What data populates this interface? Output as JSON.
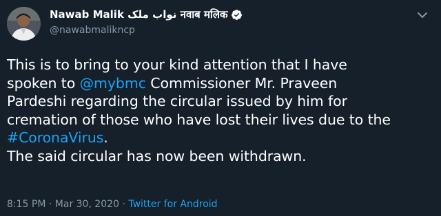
{
  "user": {
    "display_name": "Nawab Malik نواب ملک नवाब मलिक",
    "handle": "@nawabmalikncp"
  },
  "tweet": {
    "line1": "This is to bring to your kind attention that I have",
    "line2_pre": "spoken to ",
    "mention": "@mybmc",
    "line2_post": " Commissioner Mr. Praveen",
    "line3": "Pardeshi regarding the circular issued by him for",
    "line4": "cremation of those who have lost their lives due to the",
    "hashtag": "#CoronaVirus",
    "line5_post": ".",
    "line6": "The said circular has now been withdrawn."
  },
  "meta": {
    "time": "8:15 PM",
    "separator1": " · ",
    "date": "Mar 30, 2020",
    "separator2": " · ",
    "source": "Twitter for Android"
  },
  "colors": {
    "background": "#15202b",
    "link": "#1da1f2",
    "secondary_text": "#8899a6"
  },
  "icons": {
    "verified": "verified-badge-icon",
    "more": "chevron-down-icon"
  }
}
